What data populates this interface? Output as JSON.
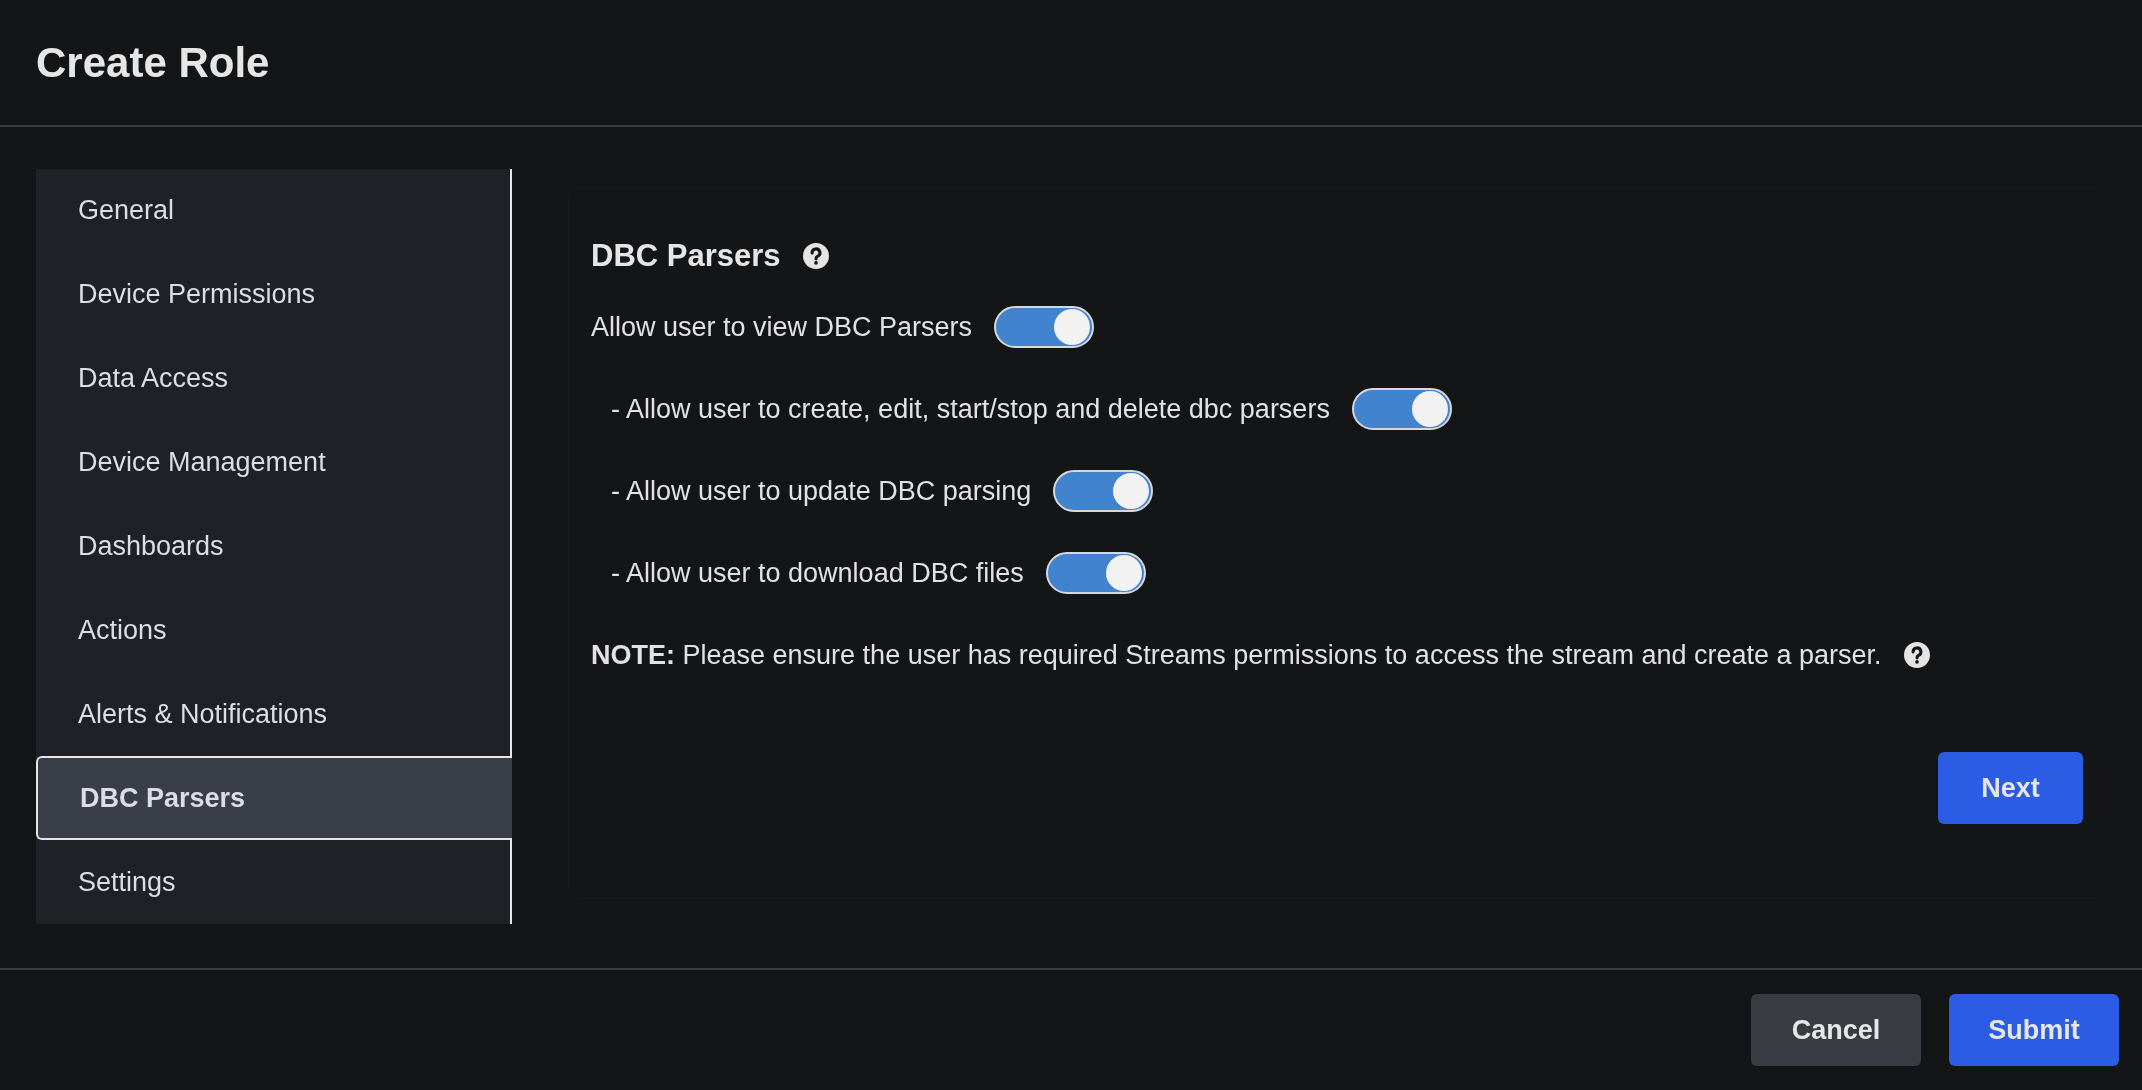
{
  "window": {
    "title": "Create Role"
  },
  "sidebar": {
    "items": [
      {
        "label": "General",
        "selected": false
      },
      {
        "label": "Device Permissions",
        "selected": false
      },
      {
        "label": "Data Access",
        "selected": false
      },
      {
        "label": "Device Management",
        "selected": false
      },
      {
        "label": "Dashboards",
        "selected": false
      },
      {
        "label": "Actions",
        "selected": false
      },
      {
        "label": "Alerts & Notifications",
        "selected": false
      },
      {
        "label": "DBC Parsers",
        "selected": true
      },
      {
        "label": "Settings",
        "selected": false
      }
    ]
  },
  "section": {
    "title": "DBC Parsers",
    "permissions": [
      {
        "label": "Allow user to view DBC Parsers",
        "on": true,
        "children": [
          {
            "label": "- Allow user to create, edit, start/stop and delete dbc parsers",
            "on": true
          },
          {
            "label": "- Allow user to update DBC parsing",
            "on": true
          },
          {
            "label": "- Allow user to download DBC files",
            "on": true
          }
        ]
      }
    ],
    "note": "**NOTE:** Please ensure the user has required Streams permissions to access the stream and create a parser.",
    "next_button": "Next"
  },
  "footer": {
    "buttons": [
      {
        "label": "Cancel",
        "kind": "secondary"
      },
      {
        "label": "Submit",
        "kind": "primary"
      }
    ]
  }
}
